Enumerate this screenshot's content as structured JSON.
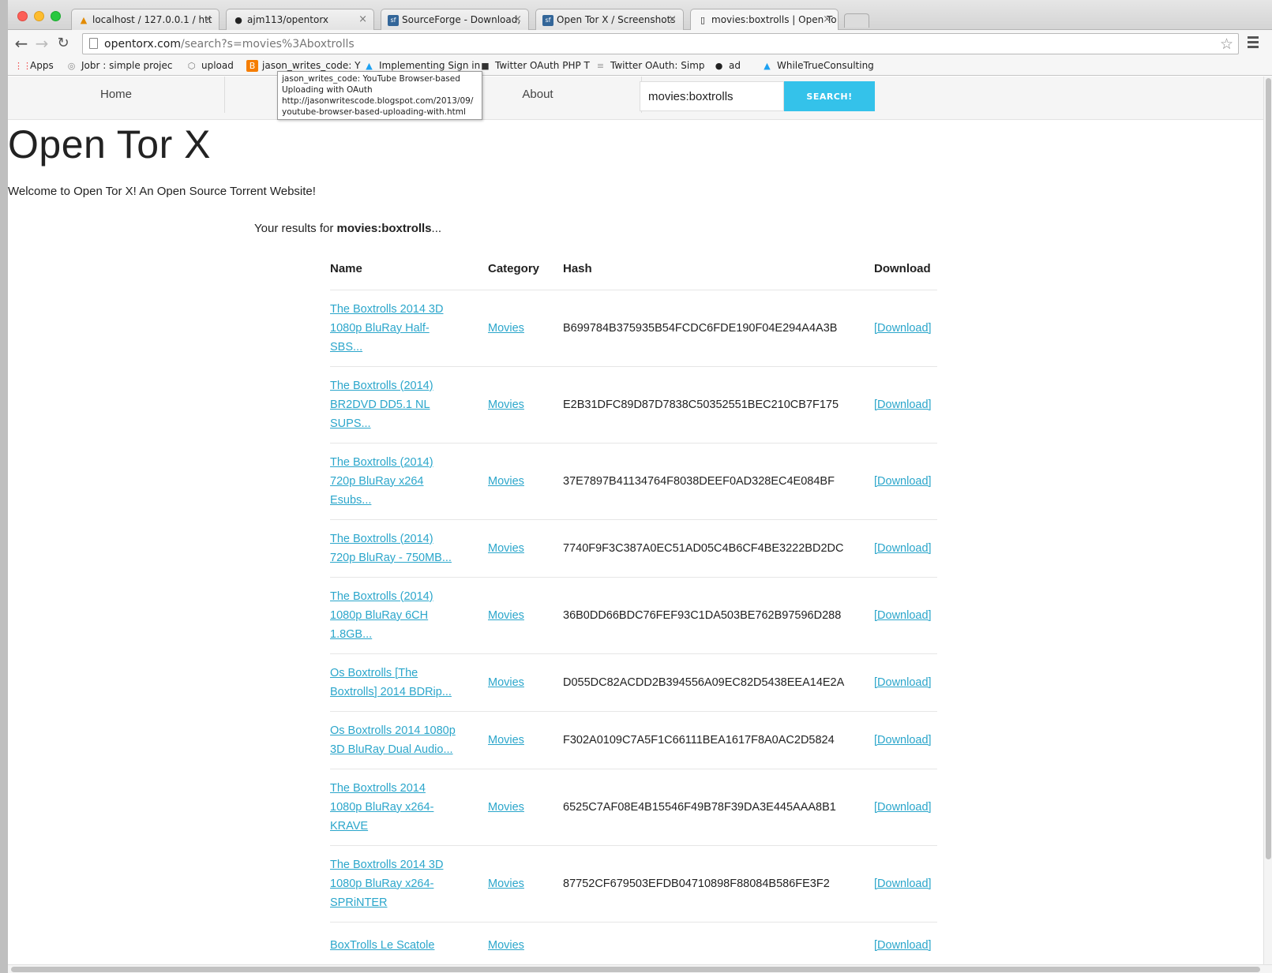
{
  "browser": {
    "tabs": [
      {
        "label": "localhost / 127.0.0.1 / htt",
        "icon": "phpmyadmin-icon"
      },
      {
        "label": "ajm113/opentorx",
        "icon": "github-icon"
      },
      {
        "label": "SourceForge - Download, ",
        "icon": "sourceforge-icon"
      },
      {
        "label": "Open Tor X / Screenshots",
        "icon": "sourceforge-icon"
      },
      {
        "label": "movies:boxtrolls | Open To",
        "icon": "page-icon"
      }
    ],
    "url_host": "opentorx.com",
    "url_path": "/search?s=movies%3Aboxtrolls",
    "bookmarks": [
      {
        "label": "Apps"
      },
      {
        "label": "Jobr : simple projec"
      },
      {
        "label": "upload"
      },
      {
        "label": "jason_writes_code: Y"
      },
      {
        "label": "Implementing Sign in"
      },
      {
        "label": "Twitter OAuth PHP T"
      },
      {
        "label": "Twitter OAuth: Simp"
      },
      {
        "label": "ad"
      },
      {
        "label": "WhileTrueConsulting"
      }
    ],
    "tooltip": {
      "line1": "jason_writes_code: YouTube Browser-based",
      "line2": "Uploading with OAuth",
      "line3": "http://jasonwritescode.blogspot.com/2013/09/",
      "line4": "youtube-browser-based-uploading-with.html"
    }
  },
  "nav": {
    "home": "Home",
    "about": "About",
    "search_value": "movies:boxtrolls",
    "search_button": "SEARCH!"
  },
  "site": {
    "title": "Open Tor X",
    "welcome": "Welcome to Open Tor X! An Open Source Torrent Website!",
    "results_prefix": "Your results for ",
    "results_query": "movies:boxtrolls",
    "results_suffix": "..."
  },
  "table": {
    "headers": {
      "name": "Name",
      "category": "Category",
      "hash": "Hash",
      "download": "Download"
    },
    "rows": [
      {
        "name_lines": [
          "The Boxtrolls 2014 3D",
          "1080p BluRay Half-",
          "SBS..."
        ],
        "category": "Movies",
        "hash": "B699784B375935B54FCDC6FDE190F04E294A4A3B",
        "download": "[Download]"
      },
      {
        "name_lines": [
          "The Boxtrolls (2014)",
          "BR2DVD DD5.1 NL",
          "SUPS..."
        ],
        "category": "Movies",
        "hash": "E2B31DFC89D87D7838C50352551BEC210CB7F175",
        "download": "[Download]"
      },
      {
        "name_lines": [
          "The Boxtrolls (2014)",
          "720p BluRay x264",
          "Esubs..."
        ],
        "category": "Movies",
        "hash": "37E7897B41134764F8038DEEF0AD328EC4E084BF",
        "download": "[Download]"
      },
      {
        "name_lines": [
          "The Boxtrolls (2014)",
          "720p BluRay - 750MB..."
        ],
        "category": "Movies",
        "hash": "7740F9F3C387A0EC51AD05C4B6CF4BE3222BD2DC",
        "download": "[Download]"
      },
      {
        "name_lines": [
          "The Boxtrolls (2014)",
          "1080p BluRay 6CH",
          "1.8GB..."
        ],
        "category": "Movies",
        "hash": "36B0DD66BDC76FEF93C1DA503BE762B97596D288",
        "download": "[Download]"
      },
      {
        "name_lines": [
          "Os Boxtrolls [The",
          "Boxtrolls] 2014 BDRip..."
        ],
        "category": "Movies",
        "hash": "D055DC82ACDD2B394556A09EC82D5438EEA14E2A",
        "download": "[Download]"
      },
      {
        "name_lines": [
          "Os Boxtrolls 2014 1080p",
          "3D BluRay Dual Audio..."
        ],
        "category": "Movies",
        "hash": "F302A0109C7A5F1C66111BEA1617F8A0AC2D5824",
        "download": "[Download]"
      },
      {
        "name_lines": [
          "The Boxtrolls 2014",
          "1080p BluRay x264-",
          "KRAVE"
        ],
        "category": "Movies",
        "hash": "6525C7AF08E4B15546F49B78F39DA3E445AAA8B1",
        "download": "[Download]"
      },
      {
        "name_lines": [
          "The Boxtrolls 2014 3D",
          "1080p BluRay x264-",
          "SPRiNTER"
        ],
        "category": "Movies",
        "hash": "87752CF679503EFDB04710898F88084B586FE3F2",
        "download": "[Download]"
      },
      {
        "name_lines": [
          "BoxTrolls Le Scatole"
        ],
        "category": "Movies",
        "hash": "",
        "download": "[Download]"
      }
    ]
  },
  "colors": {
    "accent": "#34c2ea",
    "link": "#2ba6cb"
  }
}
